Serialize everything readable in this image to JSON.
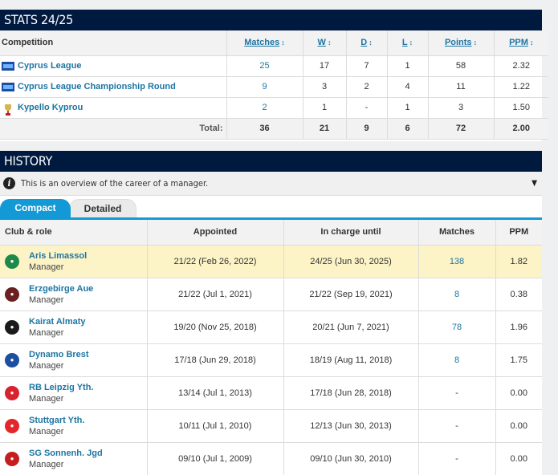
{
  "stats": {
    "title": "STATS 24/25",
    "columns": [
      "Competition",
      "Matches",
      "W",
      "D",
      "L",
      "Points",
      "PPM"
    ],
    "sort_icon": "sort-arrows-icon",
    "rows": [
      {
        "competition": "Cyprus League",
        "icon": "cyprus-league-logo-icon",
        "matches": "25",
        "w": "17",
        "d": "7",
        "l": "1",
        "points": "58",
        "ppm": "2.32"
      },
      {
        "competition": "Cyprus League Championship Round",
        "icon": "cyprus-league-logo-icon",
        "matches": "9",
        "w": "3",
        "d": "2",
        "l": "4",
        "points": "11",
        "ppm": "1.22"
      },
      {
        "competition": "Kypello Kyprou",
        "icon": "cup-trophy-icon",
        "matches": "2",
        "w": "1",
        "d": "-",
        "l": "1",
        "points": "3",
        "ppm": "1.50"
      }
    ],
    "total": {
      "label": "Total:",
      "matches": "36",
      "w": "21",
      "d": "9",
      "l": "6",
      "points": "72",
      "ppm": "2.00"
    }
  },
  "history": {
    "title": "HISTORY",
    "info_text": "This is an overview of the career of a manager.",
    "tabs": [
      "Compact",
      "Detailed"
    ],
    "active_tab": "Compact",
    "columns": [
      "Club & role",
      "Appointed",
      "In charge until",
      "Matches",
      "PPM"
    ],
    "rows": [
      {
        "club": "Aris Limassol",
        "role": "Manager",
        "appointed": "21/22 (Feb 26, 2022)",
        "until": "24/25 (Jun 30, 2025)",
        "matches": "138",
        "ppm": "1.82",
        "crest_color": "#1e8a4a",
        "highlight": true
      },
      {
        "club": "Erzgebirge Aue",
        "role": "Manager",
        "appointed": "21/22 (Jul 1, 2021)",
        "until": "21/22 (Sep 19, 2021)",
        "matches": "8",
        "ppm": "0.38",
        "crest_color": "#6b1f1f",
        "highlight": false
      },
      {
        "club": "Kairat Almaty",
        "role": "Manager",
        "appointed": "19/20 (Nov 25, 2018)",
        "until": "20/21 (Jun 7, 2021)",
        "matches": "78",
        "ppm": "1.96",
        "crest_color": "#1a1a1a",
        "highlight": false
      },
      {
        "club": "Dynamo Brest",
        "role": "Manager",
        "appointed": "17/18 (Jun 29, 2018)",
        "until": "18/19 (Aug 11, 2018)",
        "matches": "8",
        "ppm": "1.75",
        "crest_color": "#1c4fa0",
        "highlight": false
      },
      {
        "club": "RB Leipzig Yth.",
        "role": "Manager",
        "appointed": "13/14 (Jul 1, 2013)",
        "until": "17/18 (Jun 28, 2018)",
        "matches": "-",
        "ppm": "0.00",
        "crest_color": "#d8222e",
        "highlight": false
      },
      {
        "club": "Stuttgart Yth.",
        "role": "Manager",
        "appointed": "10/11 (Jul 1, 2010)",
        "until": "12/13 (Jun 30, 2013)",
        "matches": "-",
        "ppm": "0.00",
        "crest_color": "#e3262b",
        "highlight": false
      },
      {
        "club": "SG Sonnenh. Jgd",
        "role": "Manager",
        "appointed": "09/10 (Jul 1, 2009)",
        "until": "09/10 (Jun 30, 2010)",
        "matches": "-",
        "ppm": "0.00",
        "crest_color": "#c41e1e",
        "highlight": false
      }
    ]
  },
  "colors": {
    "header_bg": "#00193f",
    "link": "#1d75a3",
    "accent": "#139ad6",
    "highlight_row": "#fcf4c6"
  }
}
